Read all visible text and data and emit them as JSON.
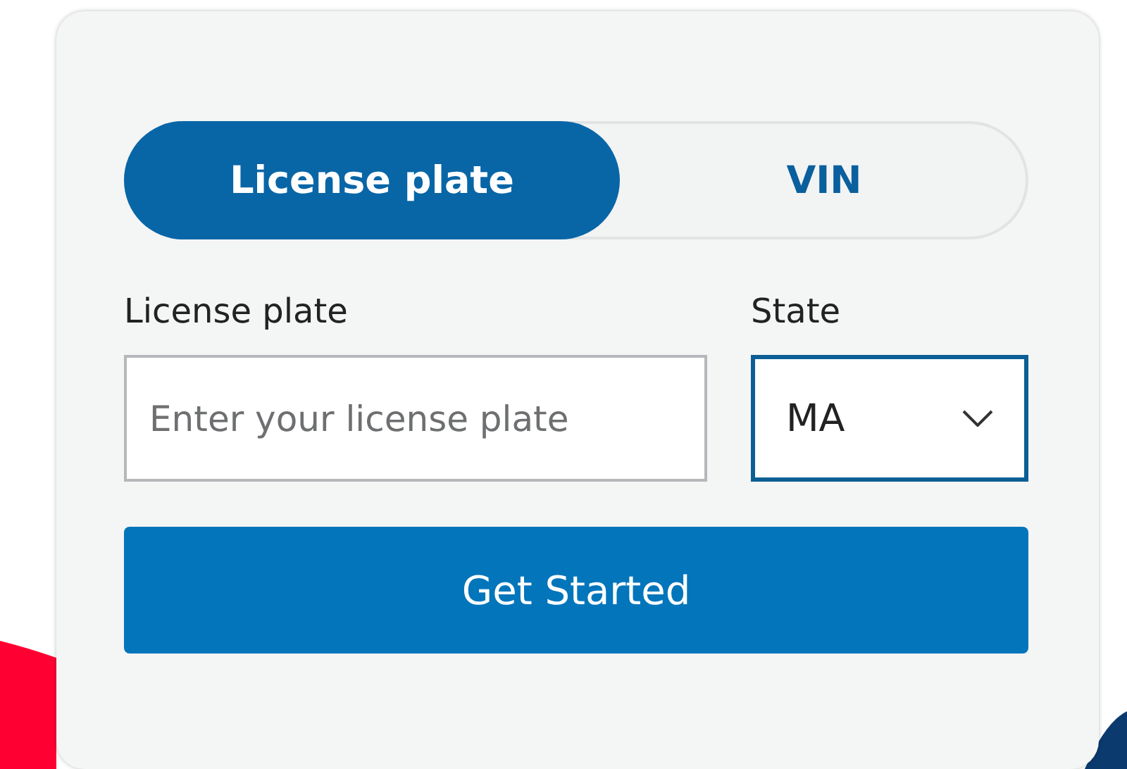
{
  "tabs": [
    {
      "label": "License plate",
      "selected": true
    },
    {
      "label": "VIN",
      "selected": false
    }
  ],
  "plate_field": {
    "label": "License plate",
    "placeholder": "Enter your license plate"
  },
  "state_field": {
    "label": "State",
    "value": "MA"
  },
  "submit_button": {
    "label": "Get Started"
  }
}
